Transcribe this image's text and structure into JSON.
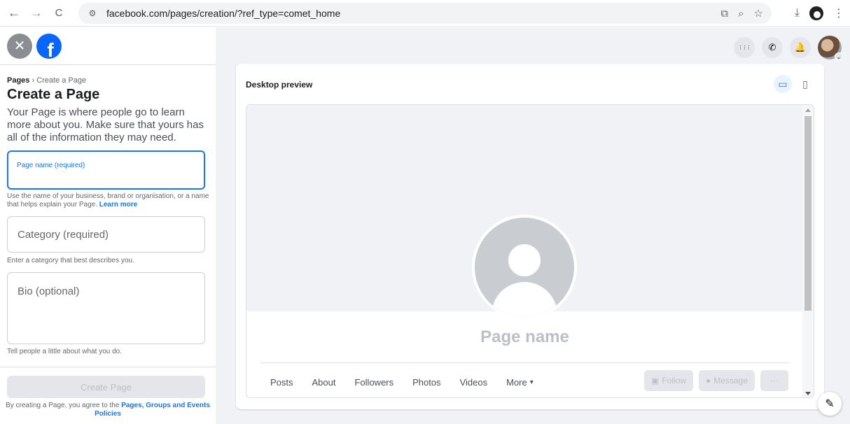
{
  "browser": {
    "url": "facebook.com/pages/creation/?ref_type=comet_home",
    "back_icon": "←",
    "forward_icon": "→",
    "reload_icon": "C",
    "site_info_icon": "⚙",
    "cast_icon": "⧉",
    "zoom_icon": "⌕",
    "bookmark_icon": "☆",
    "download_icon": "⤓",
    "menu_icon": "⋮"
  },
  "left": {
    "close_icon": "✕",
    "logo_letter": "f",
    "breadcrumb_root": "Pages",
    "breadcrumb_sep": " › ",
    "breadcrumb_current": "Create a Page",
    "title": "Create a Page",
    "description": "Your Page is where people go to learn more about you. Make sure that yours has all of the information they may need.",
    "page_name_label": "Page name (required)",
    "page_name_hint": "Use the name of your business, brand or organisation, or a name that helps explain your Page.",
    "learn_more": "Learn more",
    "category_label": "Category (required)",
    "category_hint": "Enter a category that best describes you.",
    "bio_label": "Bio (optional)",
    "bio_hint": "Tell people a little about what you do.",
    "create_button": "Create Page",
    "terms_prefix": "By creating a Page, you agree to the ",
    "terms_link": "Pages, Groups and Events Policies"
  },
  "topbar": {
    "menu_icon": "⋮⋮⋮",
    "messenger_icon": "✆",
    "notification_icon": "🔔",
    "avatar_badge": "⌄"
  },
  "preview": {
    "title": "Desktop preview",
    "desktop_icon": "▭",
    "mobile_icon": "▯",
    "page_name": "Page name",
    "tabs": [
      "Posts",
      "About",
      "Followers",
      "Photos",
      "Videos"
    ],
    "more_label": "More",
    "more_caret": "▾",
    "follow_label": "Follow",
    "follow_icon": "▣",
    "message_label": "Message",
    "message_icon": "●",
    "more_actions": "···"
  },
  "fab": {
    "edit_icon": "✎"
  }
}
